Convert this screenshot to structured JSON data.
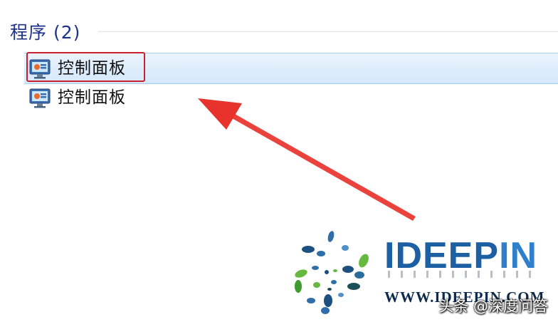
{
  "group": {
    "title": "程序 (2)"
  },
  "results": [
    {
      "label": "控制面板",
      "icon": "control-panel-icon",
      "selected": true
    },
    {
      "label": "控制面板",
      "icon": "control-panel-icon",
      "selected": false
    }
  ],
  "annotation": {
    "box_color": "#c8202e",
    "arrow_color": "#e8322c"
  },
  "logo": {
    "name_part1": "IDEEP",
    "name_part2": "IN",
    "url": "WWW.IDEEPIN.COM"
  },
  "watermark": {
    "text": "头条 @深度问答"
  }
}
